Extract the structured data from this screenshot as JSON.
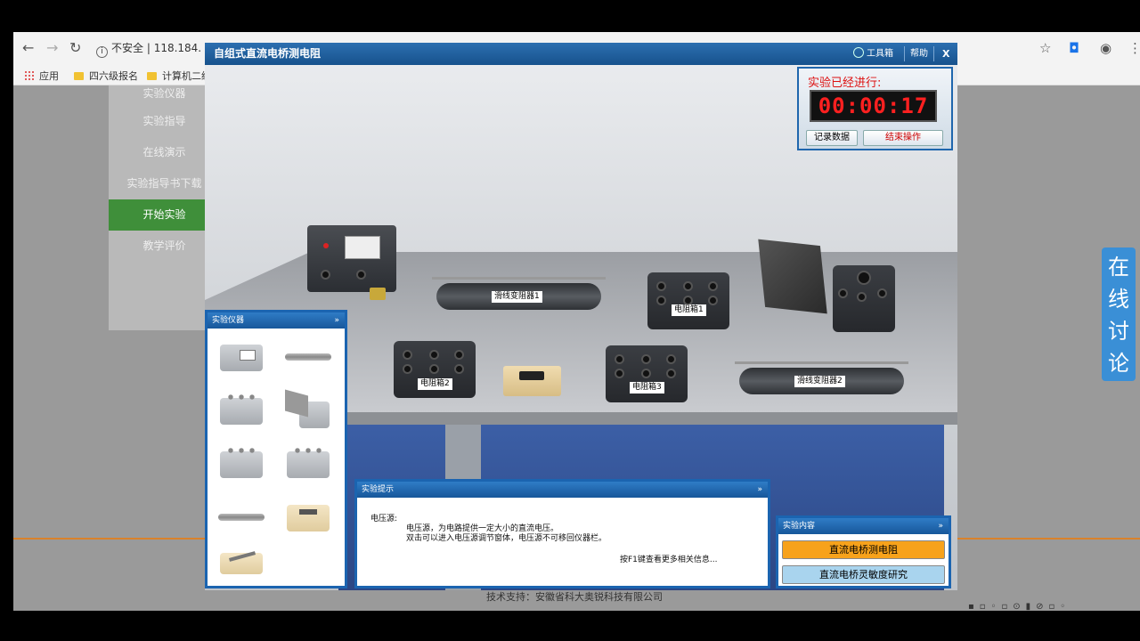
{
  "browser": {
    "back_icon": "←",
    "forward_icon": "→",
    "reload_icon": "↻",
    "security_label": "不安全",
    "url": "118.184."
  },
  "bookmarks": [
    {
      "label": "应用",
      "icon": "apps-icon"
    },
    {
      "label": "四六级报名",
      "icon": "folder-icon"
    },
    {
      "label": "计算机二级",
      "icon": "folder-icon"
    }
  ],
  "left_menu": [
    "实验仪器",
    "实验指导",
    "在线演示",
    "实验指导书下载",
    "开始实验",
    "教学评价"
  ],
  "left_menu_active": "开始实验",
  "footer_text": "技术支持：安徽省科大奥锐科技有限公司",
  "side_tab": "在线讨论",
  "sim": {
    "title": "自组式直流电桥测电阻",
    "toolbox_label": "工具箱",
    "help_label": "帮助",
    "close_label": "X",
    "timer": {
      "title": "实验已经进行:",
      "value": "00:00:17",
      "record_button": "记录数据",
      "end_button": "结束操作"
    },
    "devices": {
      "rheostat1": "滑线变阻器1",
      "rheostat2": "滑线变阻器2",
      "resbox1": "电阻箱1",
      "resbox2": "电阻箱2",
      "resbox3": "电阻箱3"
    }
  },
  "instruments_panel": {
    "title": "实验仪器",
    "collapse_icon": "»"
  },
  "hint_panel": {
    "title": "实验提示",
    "heading": "电压源:",
    "line1": "电压源，为电路提供一定大小的直流电压。",
    "line2": "双击可以进入电压源调节窗体，电压源不可移回仪器栏。",
    "more": "按F1键查看更多相关信息..."
  },
  "content_panel": {
    "title": "实验内容",
    "item1": "直流电桥测电阻",
    "item2": "直流电桥灵敏度研究",
    "colors": {
      "active": "#f7a21b",
      "inactive": "#a9d4ee"
    }
  }
}
